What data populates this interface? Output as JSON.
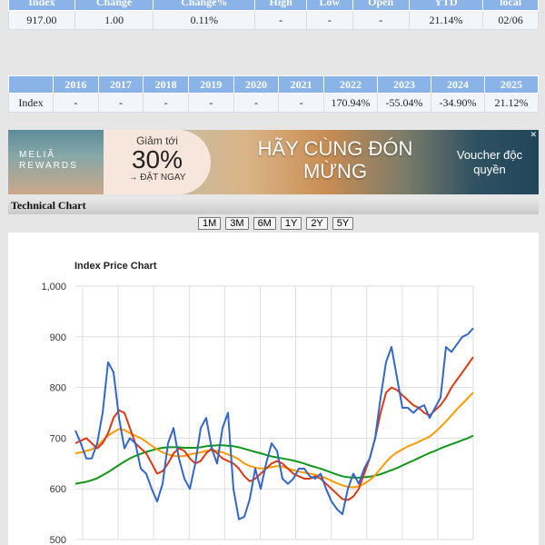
{
  "summary_table": {
    "headers": [
      "Index",
      "Change",
      "Change%",
      "High",
      "Low",
      "Open",
      "YTD",
      "local"
    ],
    "row": [
      "917.00",
      "1.00",
      "0.11%",
      "-",
      "-",
      "-",
      "21.14%",
      "02/06"
    ]
  },
  "yearly_table": {
    "headers": [
      "",
      "2016",
      "2017",
      "2018",
      "2019",
      "2020",
      "2021",
      "2022",
      "2023",
      "2024",
      "2025"
    ],
    "row_label": "Index",
    "row": [
      "-",
      "-",
      "-",
      "-",
      "-",
      "-",
      "170.94%",
      "-55.04%",
      "-34.90%",
      "21.12%"
    ]
  },
  "banner": {
    "brand_line1": "MELIÃ",
    "brand_line2": "REWARDS",
    "promo_small": "Giảm tới",
    "promo_big": "30%",
    "promo_cta": "→ ĐẶT NGAY",
    "headline_line1": "HÃY CÙNG ĐÓN",
    "headline_line2": "MỪNG",
    "voucher": "Voucher độc quyền",
    "close": "✕"
  },
  "technical_chart_label": "Technical Chart",
  "range_buttons": [
    "1M",
    "3M",
    "6M",
    "1Y",
    "2Y",
    "5Y"
  ],
  "colors": {
    "up": "#0a8a2a",
    "down": "#e02020",
    "header_blue": "#8ab3e8"
  },
  "chart_data": {
    "type": "line",
    "title": "Index Price Chart",
    "ylim": [
      500,
      1000
    ],
    "yticks": [
      "1,000",
      "900",
      "800",
      "700",
      "600",
      "500"
    ],
    "grid": true,
    "series": [
      {
        "color": "#3366cc",
        "values": [
          715,
          690,
          660,
          660,
          690,
          750,
          850,
          830,
          740,
          680,
          700,
          690,
          640,
          630,
          600,
          575,
          610,
          690,
          720,
          660,
          620,
          600,
          650,
          720,
          740,
          680,
          650,
          720,
          750,
          600,
          540,
          545,
          580,
          640,
          600,
          650,
          690,
          675,
          620,
          610,
          620,
          640,
          640,
          625,
          620,
          630,
          600,
          575,
          560,
          550,
          600,
          630,
          610,
          640,
          660,
          700,
          780,
          850,
          880,
          820,
          760,
          760,
          750,
          760,
          765,
          740,
          760,
          780,
          880,
          870,
          885,
          900,
          905,
          917
        ]
      },
      {
        "color": "#dc3912",
        "values": [
          690,
          695,
          700,
          690,
          680,
          690,
          710,
          740,
          755,
          750,
          720,
          690,
          680,
          670,
          650,
          630,
          635,
          650,
          670,
          680,
          675,
          660,
          650,
          655,
          670,
          680,
          670,
          660,
          655,
          650,
          640,
          625,
          615,
          620,
          630,
          640,
          650,
          655,
          650,
          640,
          630,
          625,
          620,
          620,
          625,
          620,
          610,
          600,
          590,
          580,
          578,
          585,
          600,
          630,
          660,
          700,
          750,
          790,
          800,
          795,
          785,
          775,
          765,
          760,
          750,
          745,
          755,
          765,
          780,
          800,
          815,
          830,
          845,
          860
        ]
      },
      {
        "color": "#ff9900",
        "values": [
          670,
          672,
          675,
          678,
          685,
          695,
          705,
          712,
          718,
          716,
          710,
          705,
          700,
          693,
          685,
          678,
          672,
          668,
          665,
          664,
          665,
          668,
          670,
          672,
          675,
          676,
          675,
          672,
          668,
          664,
          658,
          650,
          645,
          642,
          640,
          641,
          643,
          645,
          644,
          640,
          637,
          634,
          632,
          630,
          628,
          625,
          621,
          616,
          611,
          607,
          604,
          603,
          605,
          610,
          617,
          627,
          640,
          653,
          664,
          672,
          678,
          684,
          688,
          693,
          698,
          703,
          712,
          722,
          733,
          745,
          757,
          768,
          779,
          790
        ]
      },
      {
        "color": "#109618",
        "values": [
          610,
          612,
          614,
          617,
          621,
          627,
          633,
          640,
          647,
          654,
          660,
          665,
          669,
          673,
          676,
          679,
          681,
          682,
          682,
          682,
          681,
          681,
          681,
          682,
          684,
          685,
          686,
          686,
          685,
          684,
          682,
          679,
          676,
          673,
          670,
          667,
          664,
          662,
          660,
          658,
          656,
          653,
          650,
          646,
          643,
          640,
          636,
          632,
          628,
          625,
          623,
          622,
          622,
          623,
          624,
          626,
          629,
          633,
          637,
          641,
          646,
          651,
          656,
          661,
          666,
          671,
          675,
          680,
          684,
          688,
          692,
          696,
          700,
          705
        ]
      }
    ]
  }
}
